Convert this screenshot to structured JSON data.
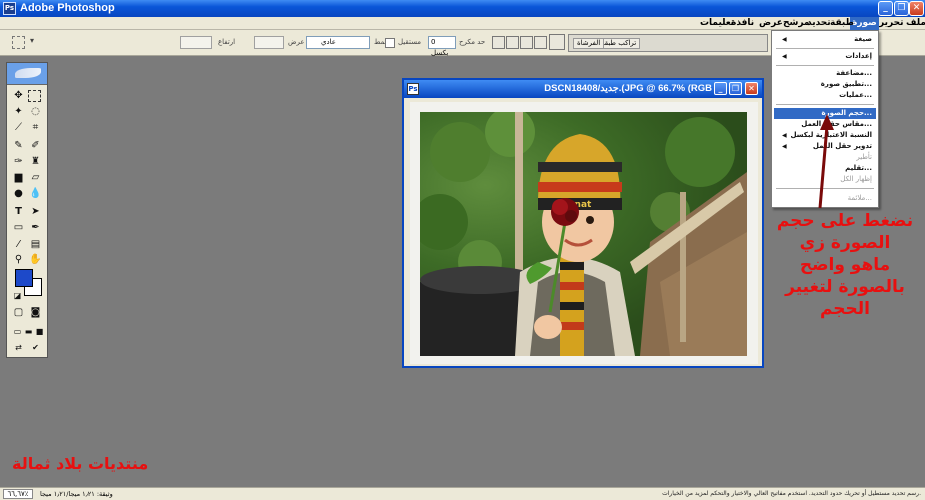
{
  "app": {
    "title": "Adobe Photoshop"
  },
  "menubar": {
    "items": [
      {
        "label": "ملف"
      },
      {
        "label": "تحرير"
      },
      {
        "label": "صورة"
      },
      {
        "label": "طبقة"
      },
      {
        "label": "تحديد"
      },
      {
        "label": "مرشح"
      },
      {
        "label": "عرض"
      },
      {
        "label": "نافذة"
      },
      {
        "label": "تعليمات"
      }
    ]
  },
  "options": {
    "style_label": "نمط",
    "style_value": "عادي",
    "width_label": "عرض",
    "height_label": "ارتفاع",
    "antialias_label": "مستقيل",
    "feather_label": "حد مكرح",
    "feather_value": "0 بكسل",
    "palette_tabs": [
      "تراكب طبقة",
      "الفرشاة"
    ]
  },
  "document": {
    "title": "DSCN1840جديد/8.(JPG @ 66.7% (RGB"
  },
  "dropdown": {
    "items": [
      {
        "label": "صيغة"
      },
      {
        "label": "إعدادات"
      },
      {
        "label": "مضاعفة..."
      },
      {
        "label": "تطبيق صورة..."
      },
      {
        "label": "عمليات..."
      },
      {
        "label": "حجم الصورة..."
      },
      {
        "label": "مقاس حقل العمل..."
      },
      {
        "label": "النسبة الاعتبارية لبكسل"
      },
      {
        "label": "تدوير حقل العمل"
      },
      {
        "label": "تأطير"
      },
      {
        "label": "تقليم..."
      },
      {
        "label": "إظهار الكل"
      },
      {
        "label": "ملائمة..."
      }
    ]
  },
  "annotation": {
    "lines": [
      "نضغط على حجم",
      "الصورة زي",
      "ماهو واضح",
      "بالصورة لتغيير",
      "الحجم"
    ]
  },
  "forum": {
    "name": "منتديات بلاد ثمالة"
  },
  "status": {
    "zoom": "٦٦,٦٧٪",
    "info": "وثيقة: ١٫٢١ ميجا/١٫٢١ ميجا",
    "help": "رسم تحديد مستطيل أو تحريك حدود التحديد. استخدم مفاتيح العالي والاختيار والتحكم لمزيد من الخيارات."
  }
}
